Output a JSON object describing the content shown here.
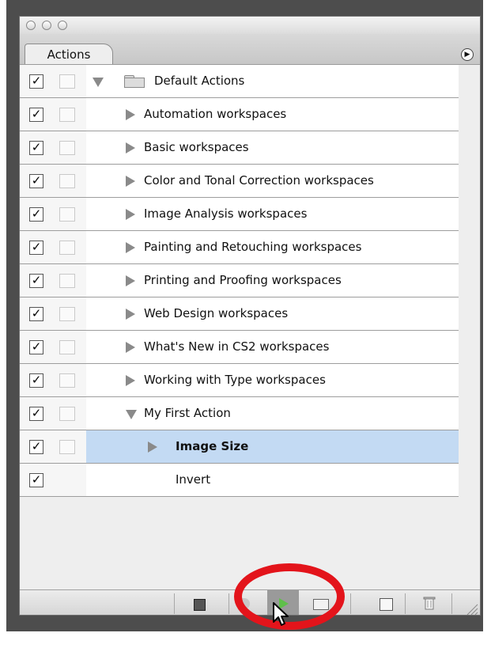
{
  "panel": {
    "tab_label": "Actions"
  },
  "actions": [
    {
      "label": "Default Actions",
      "level": 0,
      "expanded": true,
      "type": "set",
      "checked": true,
      "dialog": true
    },
    {
      "label": "Automation workspaces",
      "level": 1,
      "expanded": false,
      "type": "action",
      "checked": true,
      "dialog": true
    },
    {
      "label": "Basic workspaces",
      "level": 1,
      "expanded": false,
      "type": "action",
      "checked": true,
      "dialog": true
    },
    {
      "label": "Color and Tonal Correction workspaces",
      "level": 1,
      "expanded": false,
      "type": "action",
      "checked": true,
      "dialog": true
    },
    {
      "label": "Image Analysis workspaces",
      "level": 1,
      "expanded": false,
      "type": "action",
      "checked": true,
      "dialog": true
    },
    {
      "label": "Painting and Retouching workspaces",
      "level": 1,
      "expanded": false,
      "type": "action",
      "checked": true,
      "dialog": true
    },
    {
      "label": "Printing and Proofing workspaces",
      "level": 1,
      "expanded": false,
      "type": "action",
      "checked": true,
      "dialog": true
    },
    {
      "label": "Web Design workspaces",
      "level": 1,
      "expanded": false,
      "type": "action",
      "checked": true,
      "dialog": true
    },
    {
      "label": "What's New in CS2 workspaces",
      "level": 1,
      "expanded": false,
      "type": "action",
      "checked": true,
      "dialog": true
    },
    {
      "label": "Working with Type workspaces",
      "level": 1,
      "expanded": false,
      "type": "action",
      "checked": true,
      "dialog": true
    },
    {
      "label": "My First Action",
      "level": 1,
      "expanded": true,
      "type": "action",
      "checked": true,
      "dialog": true
    },
    {
      "label": "Image Size",
      "level": 2,
      "expanded": false,
      "type": "command",
      "checked": true,
      "dialog": true,
      "selected": true
    },
    {
      "label": "Invert",
      "level": 2,
      "expanded": null,
      "type": "command",
      "checked": true,
      "dialog": false
    }
  ],
  "toolbar": {
    "buttons": [
      "stop-icon",
      "record-icon",
      "play-icon",
      "folder-icon",
      "new-action-icon",
      "trash-icon"
    ],
    "highlighted": "play-icon"
  },
  "colors": {
    "selection": "#c3daf3",
    "annotation": "#e3141b"
  }
}
